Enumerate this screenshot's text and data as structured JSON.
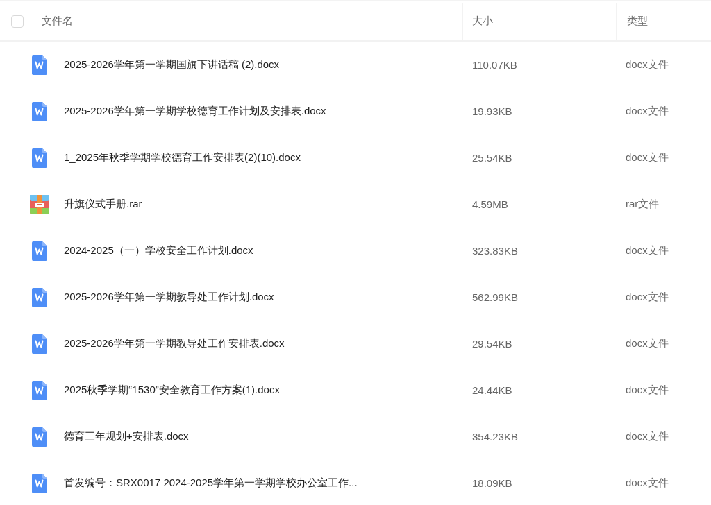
{
  "table": {
    "select_all": {
      "checked": false
    },
    "columns": [
      "文件名",
      "大小",
      "类型"
    ],
    "rows": [
      {
        "kind": "docx",
        "name": "2025-2026学年第一学期国旗下讲话稿 (2).docx",
        "size": "110.07KB",
        "type": "docx文件"
      },
      {
        "kind": "docx",
        "name": "2025-2026学年第一学期学校德育工作计划及安排表.docx",
        "size": "19.93KB",
        "type": "docx文件"
      },
      {
        "kind": "docx",
        "name": "1_2025年秋季学期学校德育工作安排表(2)(10).docx",
        "size": "25.54KB",
        "type": "docx文件"
      },
      {
        "kind": "rar",
        "name": "升旗仪式手册.rar",
        "size": "4.59MB",
        "type": "rar文件"
      },
      {
        "kind": "docx",
        "name": "2024-2025（一）学校安全工作计划.docx",
        "size": "323.83KB",
        "type": "docx文件"
      },
      {
        "kind": "docx",
        "name": "2025-2026学年第一学期教导处工作计划.docx",
        "size": "562.99KB",
        "type": "docx文件"
      },
      {
        "kind": "docx",
        "name": "2025-2026学年第一学期教导处工作安排表.docx",
        "size": "29.54KB",
        "type": "docx文件"
      },
      {
        "kind": "docx",
        "name": "2025秋季学期“1530”安全教育工作方案(1).docx",
        "size": "24.44KB",
        "type": "docx文件"
      },
      {
        "kind": "docx",
        "name": "德育三年规划+安排表.docx",
        "size": "354.23KB",
        "type": "docx文件"
      },
      {
        "kind": "docx",
        "name": "首发编号：SRX0017 2024-2025学年第一学期学校办公室工作...",
        "size": "18.09KB",
        "type": "docx文件"
      }
    ]
  }
}
